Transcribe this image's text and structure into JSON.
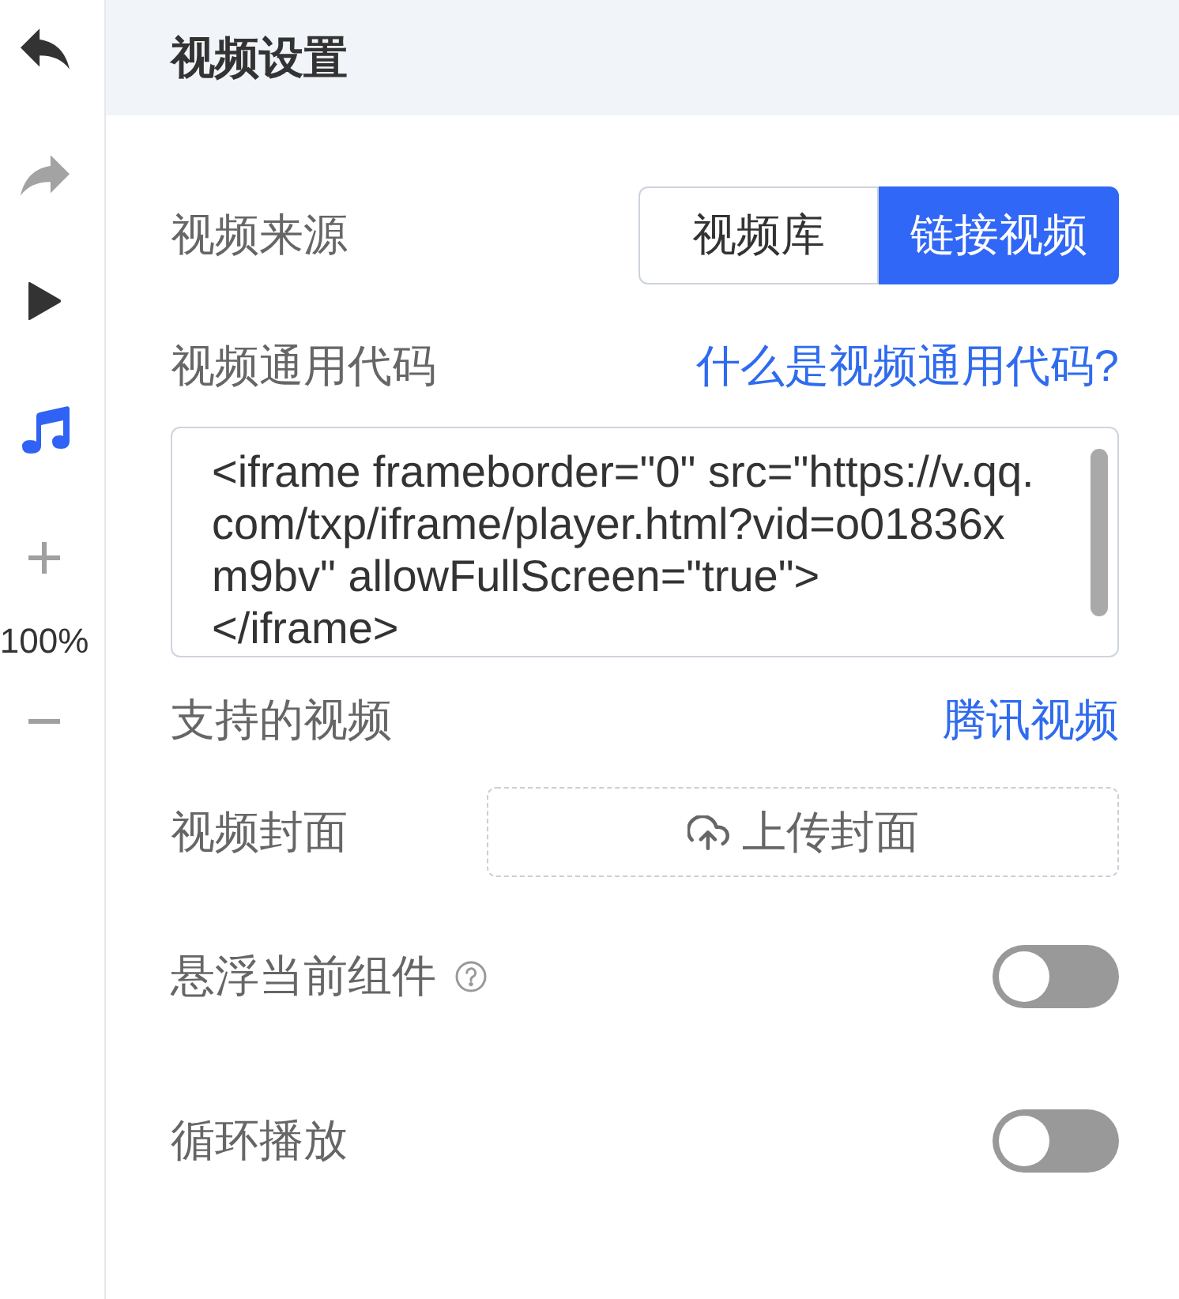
{
  "toolbar": {
    "tools": [
      {
        "kind": "undo",
        "disabled": false,
        "active": false
      },
      {
        "kind": "redo",
        "disabled": true,
        "active": false
      },
      {
        "kind": "play",
        "disabled": false,
        "active": false
      },
      {
        "kind": "music",
        "disabled": false,
        "active": true
      }
    ],
    "zoom": {
      "value": "100%"
    }
  },
  "panel": {
    "title": "视频设置",
    "source": {
      "label": "视频来源",
      "options": [
        {
          "label": "视频库",
          "selected": false
        },
        {
          "label": "链接视频",
          "selected": true
        }
      ]
    },
    "embed_code": {
      "label": "视频通用代码",
      "help_link": "什么是视频通用代码?",
      "value": "<iframe frameborder=\"0\" src=\"https://v.qq.com/txp/iframe/player.html?vid=o01836xm9bv\" allowFullScreen=\"true\">\n</iframe>"
    },
    "supported": {
      "label": "支持的视频",
      "value": "腾讯视频"
    },
    "cover": {
      "label": "视频封面",
      "upload_button": "上传封面"
    },
    "toggles": [
      {
        "label": "悬浮当前组件",
        "help_icon": true,
        "on": false
      },
      {
        "label": "循环播放",
        "help_icon": false,
        "on": false
      }
    ]
  }
}
